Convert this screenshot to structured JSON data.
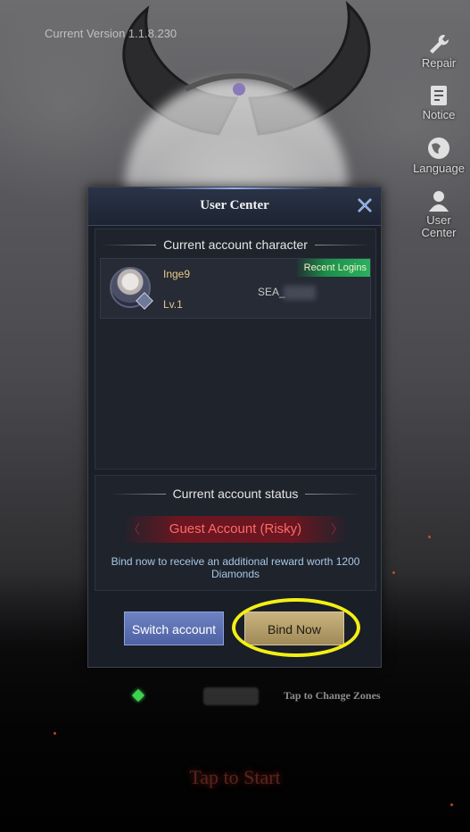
{
  "top": {
    "version_text": "Current Version 1.1.8.230"
  },
  "side_menu": [
    {
      "label": "Repair",
      "icon": "wrench-icon"
    },
    {
      "label": "Notice",
      "icon": "notice-icon"
    },
    {
      "label": "Language",
      "icon": "globe-icon"
    },
    {
      "label": "User\nCenter",
      "icon": "user-icon"
    }
  ],
  "dialog": {
    "title": "User Center",
    "character_section": {
      "heading": "Current account character",
      "character": {
        "name": "Inge9",
        "level": "Lv.1",
        "server": "SEA_",
        "tag": "Recent Logins"
      }
    },
    "status_section": {
      "heading": "Current account status",
      "status_label": "Guest Account (Risky)",
      "reward_text": "Bind now to receive an additional reward worth 1200 Diamonds"
    },
    "buttons": {
      "switch": "Switch account",
      "bind": "Bind Now"
    }
  },
  "zone": {
    "change_text": "Tap to Change Zones"
  },
  "start": {
    "label": "Tap to Start"
  },
  "colors": {
    "accent_highlight": "#f3ef16",
    "guest_warning": "#ff6a6a",
    "recent_tag": "#1c8f4a",
    "switch_button": "#5b6fb0",
    "bind_button": "#b59f6b"
  }
}
